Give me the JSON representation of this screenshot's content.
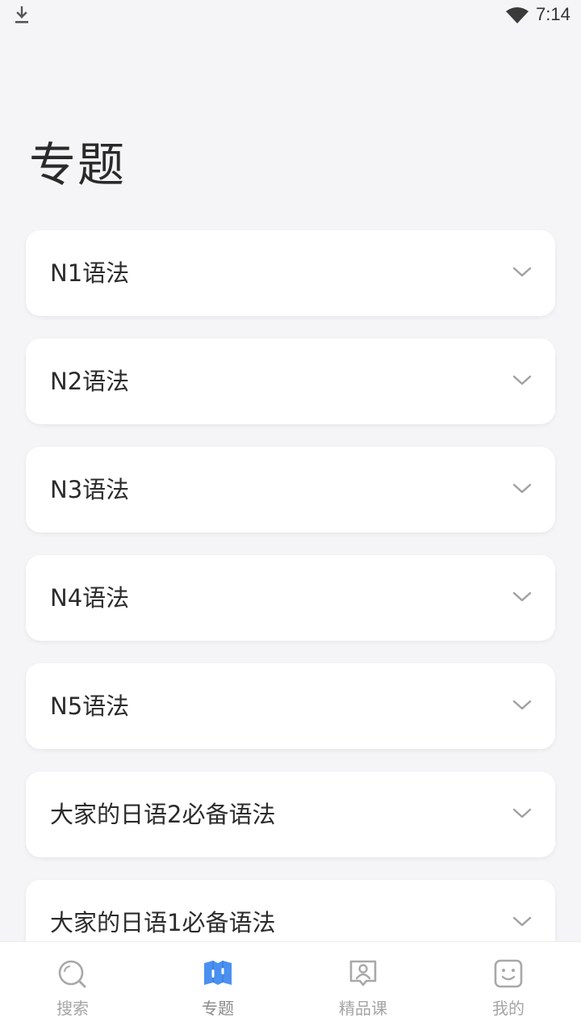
{
  "status_bar": {
    "time": "7:14",
    "download_icon": "download-icon",
    "wifi_icon": "wifi-icon"
  },
  "page": {
    "title": "专题"
  },
  "topics": [
    {
      "label": "N1语法"
    },
    {
      "label": "N2语法"
    },
    {
      "label": "N3语法"
    },
    {
      "label": "N4语法"
    },
    {
      "label": "N5语法"
    },
    {
      "label": "大家的日语2必备语法"
    },
    {
      "label": "大家的日语1必备语法"
    }
  ],
  "bottom_nav": {
    "items": [
      {
        "label": "搜索",
        "icon": "search-icon"
      },
      {
        "label": "专题",
        "icon": "topic-book-icon",
        "active": true
      },
      {
        "label": "精品课",
        "icon": "course-icon"
      },
      {
        "label": "我的",
        "icon": "profile-face-icon"
      }
    ]
  },
  "colors": {
    "background": "#f5f5f7",
    "card": "#ffffff",
    "accent": "#4a90f0",
    "icon_gray": "#a8a8a8",
    "chevron": "#a0a0a0"
  }
}
